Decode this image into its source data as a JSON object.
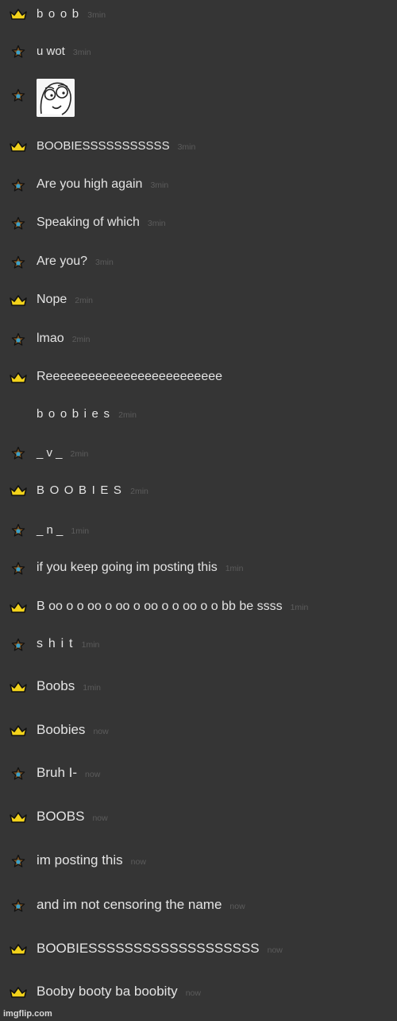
{
  "colors": {
    "background": "#353535",
    "message_text": "#e4e4e4",
    "timestamp": "#5c5c5c",
    "crown": "#f2d21b",
    "star_outer": "#7a4f1e",
    "star_inner": "#3aa0c8"
  },
  "messages": [
    {
      "badge": "crown-icon",
      "text": "b o o b",
      "time": "3min",
      "spaced": true
    },
    {
      "badge": "star-icon",
      "text": "u wot",
      "time": "3min"
    },
    {
      "badge": "star-icon",
      "image": "rage-face-meme",
      "text": "",
      "time": ""
    },
    {
      "badge": "crown-icon",
      "text": "BOOBIESSSSSSSSSSS",
      "time": "3min"
    },
    {
      "badge": "star-icon",
      "text": "Are you high again",
      "time": "3min"
    },
    {
      "badge": "star-icon",
      "text": "Speaking of which",
      "time": "3min"
    },
    {
      "badge": "star-icon",
      "text": "Are you?",
      "time": "3min"
    },
    {
      "badge": "crown-icon",
      "text": "Nope",
      "time": "2min"
    },
    {
      "badge": "star-icon",
      "text": "lmao",
      "time": "2min"
    },
    {
      "badge": "crown-icon",
      "text": "Reeeeeeeeeeeeeeeeeeeeeeeee",
      "time": ""
    },
    {
      "badge": "",
      "text": "b o o b i e s",
      "time": "2min",
      "spaced": true
    },
    {
      "badge": "star-icon",
      "text": "_ v _",
      "time": "2min"
    },
    {
      "badge": "crown-icon",
      "text": "B O O B I E S",
      "time": "2min",
      "spaced": true
    },
    {
      "badge": "star-icon",
      "text": "_ n _",
      "time": "1min"
    },
    {
      "badge": "star-icon",
      "text": "if you keep going im posting this",
      "time": "1min"
    },
    {
      "badge": "crown-icon",
      "text": "B oo o o oo o oo o oo o o oo o o bb be ssss",
      "time": "1min"
    },
    {
      "badge": "star-icon",
      "text": "s h i t",
      "time": "1min",
      "spaced": true
    },
    {
      "badge": "crown-icon",
      "text": "Boobs",
      "time": "1min"
    },
    {
      "badge": "crown-icon",
      "text": "Boobies",
      "time": "now"
    },
    {
      "badge": "star-icon",
      "text": "Bruh I-",
      "time": "now"
    },
    {
      "badge": "crown-icon",
      "text": "BOOBS",
      "time": "now"
    },
    {
      "badge": "star-icon",
      "text": "im posting this",
      "time": "now"
    },
    {
      "badge": "star-icon",
      "text": "and im not censoring the name",
      "time": "now"
    },
    {
      "badge": "crown-icon",
      "text": "BOOBIESSSSSSSSSSSSSSSSSSS",
      "time": "now"
    },
    {
      "badge": "crown-icon",
      "text": "Booby booty ba boobity",
      "time": "now"
    }
  ],
  "watermark": "imgflip.com"
}
